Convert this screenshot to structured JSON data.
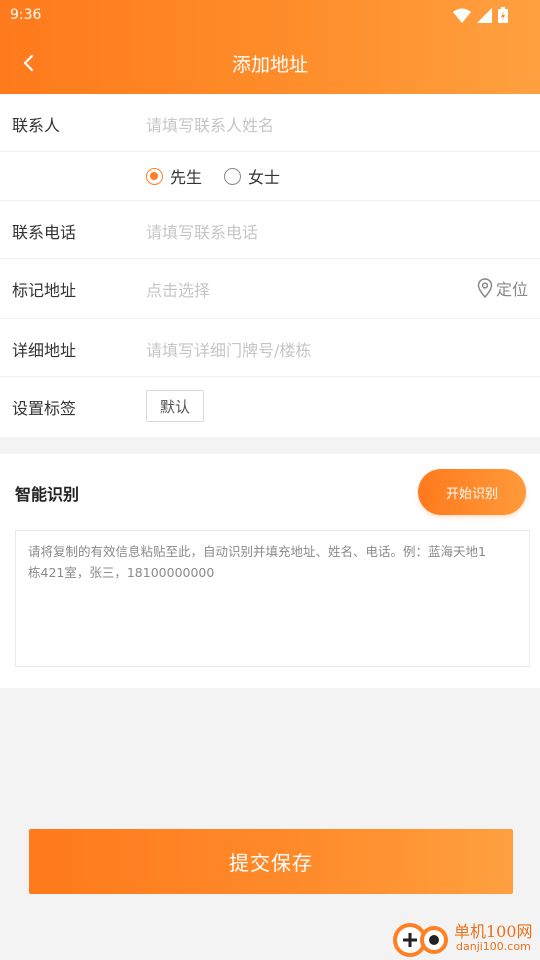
{
  "status_bar": {
    "time": "9:36"
  },
  "header": {
    "title": "添加地址",
    "back_icon": "chevron-left-icon"
  },
  "form": {
    "contact": {
      "label": "联系人",
      "placeholder": "请填写联系人姓名"
    },
    "gender": {
      "options": [
        {
          "label": "先生",
          "selected": true
        },
        {
          "label": "女士",
          "selected": false
        }
      ]
    },
    "phone": {
      "label": "联系电话",
      "placeholder": "请填写联系电话"
    },
    "mark_address": {
      "label": "标记地址",
      "placeholder": "点击选择",
      "locate_label": "定位",
      "locate_icon": "location-pin-icon"
    },
    "detail_address": {
      "label": "详细地址",
      "placeholder": "请填写详细门牌号/楼栋"
    },
    "tag": {
      "label": "设置标签",
      "default_tag": "默认"
    }
  },
  "smart_recognition": {
    "title": "智能识别",
    "button_label": "开始识别",
    "placeholder_line1": "请将复制的有效信息粘贴至此，自动识别并填充地址、姓名、电话。例：蓝海天地1",
    "placeholder_line2": "栋421室，张三，18100000000"
  },
  "submit": {
    "label": "提交保存"
  },
  "watermark": {
    "brand": "单机100网",
    "domain": "danji100.com"
  },
  "colors": {
    "accent": "#ff7f24",
    "accent_light": "#ffa040",
    "placeholder": "#c6c6c6"
  }
}
